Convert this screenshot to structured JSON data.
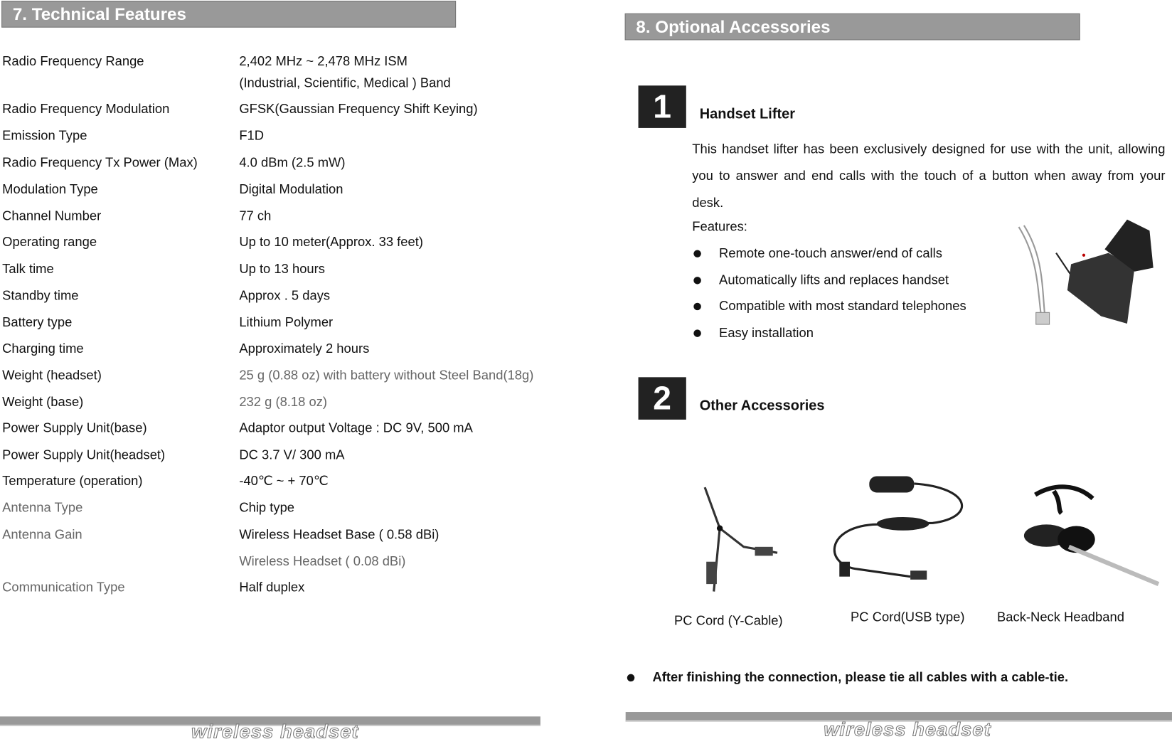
{
  "left": {
    "title": "7. Technical Features",
    "rows": [
      {
        "label": "Radio Frequency Range",
        "value": "2,402 MHz ~ 2,478 MHz ISM",
        "value2": " (Industrial, Scientific, Medical ) Band"
      },
      {
        "label": "Radio Frequency Modulation",
        "value": "GFSK(Gaussian Frequency Shift Keying)"
      },
      {
        "label": "Emission Type",
        "value": " F1D"
      },
      {
        "label": "Radio Frequency Tx Power (Max)",
        "value": "4.0 dBm (2.5 mW)"
      },
      {
        "label": "Modulation Type",
        "value": " Digital Modulation"
      },
      {
        "label": "Channel Number",
        "value": " 77 ch"
      },
      {
        "label": "Operating range",
        "value": "Up to 10 meter(Approx. 33 feet)"
      },
      {
        "label": "Talk time",
        "value": "Up to 13 hours"
      },
      {
        "label": "Standby time",
        "value": "Approx . 5 days"
      },
      {
        "label": "Battery type",
        "value": "Lithium Polymer"
      },
      {
        "label": "Charging time",
        "value": "Approximately 2 hours"
      },
      {
        "label": "Weight (headset)",
        "value": "25 g (0.88 oz) with battery without Steel Band(18g)"
      },
      {
        "label": "Weight (base)",
        "value": "232 g (8.18 oz)"
      },
      {
        "label": "Power Supply Unit(base)",
        "value": "Adaptor output Voltage : DC 9V, 500 mA"
      },
      {
        "label": "Power Supply Unit(headset)",
        "value": "DC 3.7 V/ 300 mA"
      },
      {
        "label": "Temperature (operation)",
        "value": "-40℃  ~ + 70℃"
      },
      {
        "label": "Antenna Type",
        "value": "Chip type"
      },
      {
        "label": "Antenna Gain",
        "value": " Wireless Headset Base ( 0.58 dBi)",
        "value2": " Wireless Headset ( 0.08 dBi)"
      },
      {
        "label": "Communication Type",
        "value": " Half duplex"
      }
    ],
    "footer": "wireless headset"
  },
  "right": {
    "title": "8. Optional Accessories",
    "s1": {
      "num": "1",
      "title": "Handset Lifter",
      "desc": "This handset lifter has been exclusively designed for use with the unit, allowing you to answer and end calls with the touch of a button when away from your desk.",
      "features_label": "Features:",
      "features": [
        "Remote one-touch answer/end of calls",
        "Automatically lifts and replaces handset",
        "Compatible with most standard telephones",
        "Easy installation"
      ]
    },
    "s2": {
      "num": "2",
      "title": "Other Accessories",
      "items": [
        "PC Cord (Y-Cable)",
        "PC Cord(USB type)",
        "Back-Neck Headband"
      ]
    },
    "note": "After finishing the connection, please tie all cables with a cable-tie.",
    "footer": "wireless headset"
  }
}
